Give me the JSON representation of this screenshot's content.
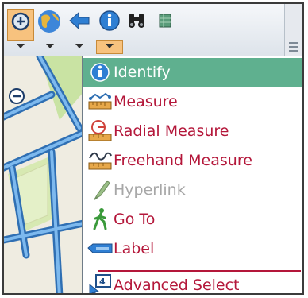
{
  "toolbar": {
    "tools": [
      {
        "icon": "zoom-in-icon"
      },
      {
        "icon": "globe-icon"
      },
      {
        "icon": "back-arrow-icon"
      },
      {
        "icon": "info-icon"
      },
      {
        "icon": "binoculars-icon"
      },
      {
        "icon": "map-sheet-icon"
      }
    ]
  },
  "menu": {
    "items": [
      {
        "label": "Identify",
        "icon": "info-icon",
        "state": "highlighted"
      },
      {
        "label": "Measure",
        "icon": "ruler-icon",
        "state": "normal"
      },
      {
        "label": "Radial Measure",
        "icon": "radial-ruler-icon",
        "state": "normal"
      },
      {
        "label": "Freehand Measure",
        "icon": "freehand-ruler-icon",
        "state": "normal"
      },
      {
        "label": "Hyperlink",
        "icon": "hyperlink-icon",
        "state": "disabled"
      },
      {
        "label": "Go To",
        "icon": "walking-person-icon",
        "state": "normal"
      },
      {
        "label": "Label",
        "icon": "label-icon",
        "state": "normal"
      },
      {
        "label": "Advanced Select",
        "icon": "select-arrow-icon",
        "state": "normal"
      }
    ]
  },
  "colors": {
    "menu_text": "#b4173a",
    "highlight": "#5fb08f",
    "active_tool": "#f7c27e",
    "road_blue": "#3b8fd6",
    "parcel_green": "#c9e3a3"
  }
}
